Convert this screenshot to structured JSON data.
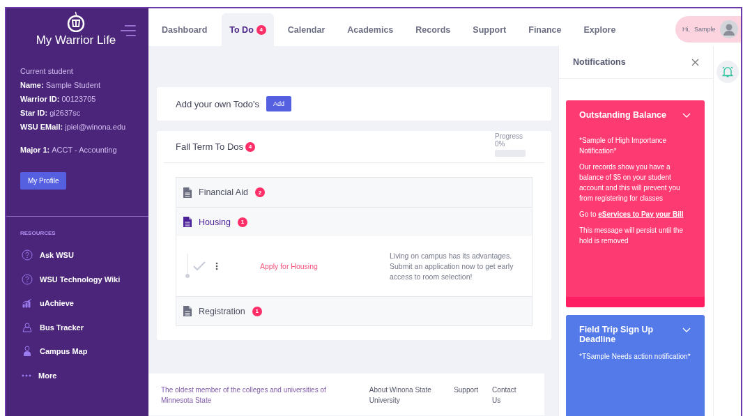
{
  "sidebar": {
    "brand": "My Warrior Life",
    "profile": [
      {
        "value": "Current student"
      },
      {
        "label": "Name:",
        "value": "Sample Student"
      },
      {
        "label": "Warrior ID:",
        "value": "00123705"
      },
      {
        "label": "Star ID:",
        "value": "gi2637sc"
      },
      {
        "label": "WSU EMail:",
        "value": "jpiel@winona.edu"
      },
      {
        "label": "Major 1:",
        "value": "ACCT - Accounting"
      }
    ],
    "profile_button": "My Profile",
    "resources_title": "RESOURCES",
    "resources": [
      {
        "label": "Ask WSU",
        "kind": "help"
      },
      {
        "label": "WSU Technology Wiki",
        "kind": "help"
      },
      {
        "label": "uAchieve",
        "kind": "chart"
      },
      {
        "label": "Bus Tracker",
        "kind": "bus"
      },
      {
        "label": "Campus Map",
        "kind": "map"
      },
      {
        "label": "More",
        "kind": "more"
      }
    ]
  },
  "nav": {
    "tabs": [
      {
        "label": "Dashboard",
        "selected": false
      },
      {
        "label": "To Do",
        "selected": true,
        "badge": "4"
      },
      {
        "label": "Calendar",
        "selected": false
      },
      {
        "label": "Academics",
        "selected": false
      },
      {
        "label": "Records",
        "selected": false
      },
      {
        "label": "Support",
        "selected": false
      },
      {
        "label": "Finance",
        "selected": false
      },
      {
        "label": "Explore",
        "selected": false
      }
    ],
    "greeting": "Hi,",
    "user": "Sample"
  },
  "add_todo": {
    "label": "Add your own Todo's",
    "button": "Add"
  },
  "term": {
    "title": "Fall Term To Dos",
    "badge": "4",
    "progress_label": "Progress",
    "progress_value": "0%",
    "level": 0,
    "groups": [
      {
        "title": "Financial Aid",
        "badge": "2",
        "expanded": false
      },
      {
        "title": "Housing",
        "badge": "1",
        "expanded": true,
        "tasks": [
          {
            "title": "Apply for Housing",
            "done": false,
            "description": "Living on campus has its advantages.  Submit an application now to get early access to room selection!"
          }
        ]
      },
      {
        "title": "Registration",
        "badge": "1",
        "expanded": false
      }
    ]
  },
  "footer": {
    "about": "The oldest member of the colleges and universities of Minnesota State",
    "links": [
      "About Winona State University",
      "Support",
      "Contact Us"
    ]
  },
  "notifications": {
    "title": "Notifications",
    "cards": [
      {
        "title": "Outstanding Balance",
        "color": "#fd3a72",
        "paragraphs": [
          {
            "text": "*Sample of High Importance Notification*"
          },
          {
            "text": "Our records show you have a balance of $5 on your student account and this will prevent you from registering for classes"
          },
          {
            "text": "Go to ",
            "link": "eServices to Pay your Bill"
          },
          {
            "text": "This message will persist until the hold is removed"
          }
        ]
      },
      {
        "title": "Field Trip Sign Up Deadline",
        "color": "#5479e8",
        "paragraphs": [
          {
            "text": "*TSample Needs action notification*"
          }
        ]
      }
    ]
  }
}
